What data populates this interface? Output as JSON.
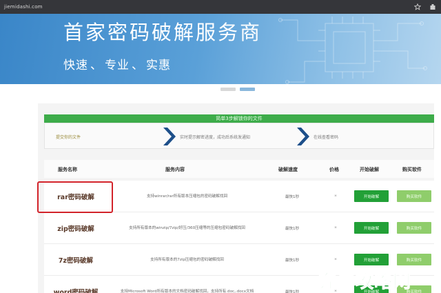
{
  "browser": {
    "url": "jiemidashi.com",
    "icons": [
      "star-icon",
      "extensions-icon"
    ]
  },
  "banner": {
    "title": "首家密码破解服务商",
    "taglines": [
      "快速",
      "专业",
      "实惠"
    ],
    "separator": "、"
  },
  "carousel": {
    "active_index": 1,
    "count": 2
  },
  "steps": {
    "header": "简单3步解锁你的文件",
    "items": [
      {
        "label": "提交你的文件"
      },
      {
        "label": "实时提示解密进度，成功后系统发通知"
      },
      {
        "label": "在线查看密码"
      }
    ]
  },
  "table": {
    "headers": {
      "name": "服务名称",
      "content": "服务内容",
      "speed": "破解速度",
      "price": "价格",
      "start": "开始破解",
      "buy": "购买软件"
    },
    "rows": [
      {
        "name": "rar密码破解",
        "desc": "支持winrar/rar所有版本压缩包的密码破解找回",
        "speed": "最快1秒",
        "price": "*",
        "start": "开始破解",
        "buy": "购买软件"
      },
      {
        "name": "zip密码破解",
        "desc": "支持所有版本的winzip/7zip/好压/360压缩等的压缩包密码破解找回",
        "speed": "最快1秒",
        "price": "*",
        "start": "开始破解",
        "buy": "购买软件"
      },
      {
        "name": "7z密码破解",
        "desc": "支持所有版本的7zip压缩包的密码破解找回",
        "speed": "最快1秒",
        "price": "*",
        "start": "开始破解",
        "buy": "购买软件"
      },
      {
        "name": "word密码破解",
        "desc": "支持Microsoft Word所有版本的文档密码破解找回，支持所有.doc,.docx文档",
        "speed": "最快1秒",
        "price": "*",
        "start": "开始破解",
        "buy": "购买软件"
      }
    ]
  },
  "watermark": {
    "text": "奔鸿攻略网"
  },
  "colors": {
    "green": "#3dac4a",
    "start_button": "#22a037",
    "buy_button": "#8fcd6b",
    "highlight": "#d2232a",
    "banner_blue": "#3a86c8"
  }
}
